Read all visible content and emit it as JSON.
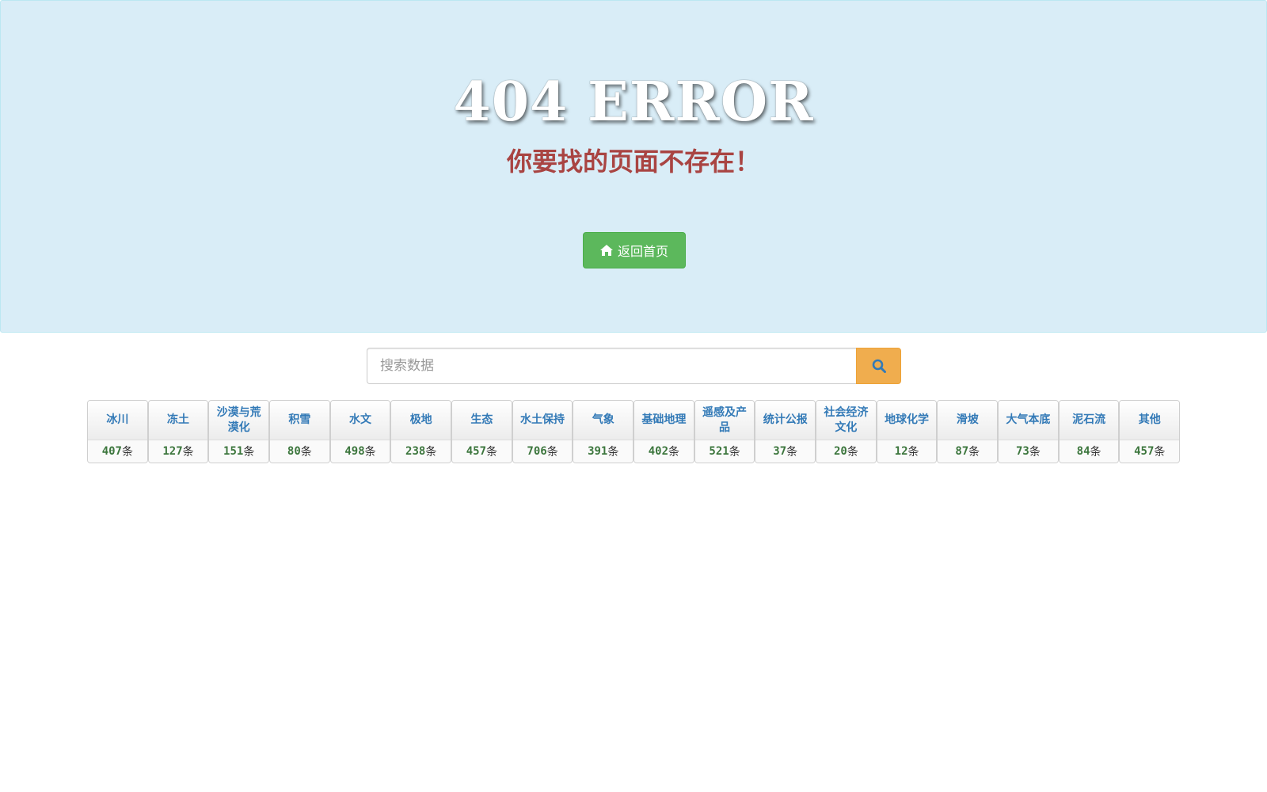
{
  "hero": {
    "title": "404 ERROR",
    "subtitle": "你要找的页面不存在！",
    "home_button_label": "返回首页",
    "home_icon": "home-icon"
  },
  "search": {
    "placeholder": "搜索数据",
    "button_icon": "search-icon"
  },
  "colors": {
    "hero_bg": "#d9edf7",
    "subtitle": "#a94442",
    "home_button": "#5cb85c",
    "search_button": "#f0ad4e",
    "category_name": "#337ab7",
    "category_count": "#3c763d"
  },
  "categories": [
    {
      "name": "冰川",
      "count": "407",
      "unit": "条"
    },
    {
      "name": "冻土",
      "count": "127",
      "unit": "条"
    },
    {
      "name": "沙漠与荒漠化",
      "count": "151",
      "unit": "条"
    },
    {
      "name": "积雪",
      "count": "80",
      "unit": "条"
    },
    {
      "name": "水文",
      "count": "498",
      "unit": "条"
    },
    {
      "name": "极地",
      "count": "238",
      "unit": "条"
    },
    {
      "name": "生态",
      "count": "457",
      "unit": "条"
    },
    {
      "name": "水土保持",
      "count": "706",
      "unit": "条"
    },
    {
      "name": "气象",
      "count": "391",
      "unit": "条"
    },
    {
      "name": "基础地理",
      "count": "402",
      "unit": "条"
    },
    {
      "name": "遥感及产品",
      "count": "521",
      "unit": "条"
    },
    {
      "name": "统计公报",
      "count": "37",
      "unit": "条"
    },
    {
      "name": "社会经济文化",
      "count": "20",
      "unit": "条"
    },
    {
      "name": "地球化学",
      "count": "12",
      "unit": "条"
    },
    {
      "name": "滑坡",
      "count": "87",
      "unit": "条"
    },
    {
      "name": "大气本底",
      "count": "73",
      "unit": "条"
    },
    {
      "name": "泥石流",
      "count": "84",
      "unit": "条"
    },
    {
      "name": "其他",
      "count": "457",
      "unit": "条"
    }
  ]
}
